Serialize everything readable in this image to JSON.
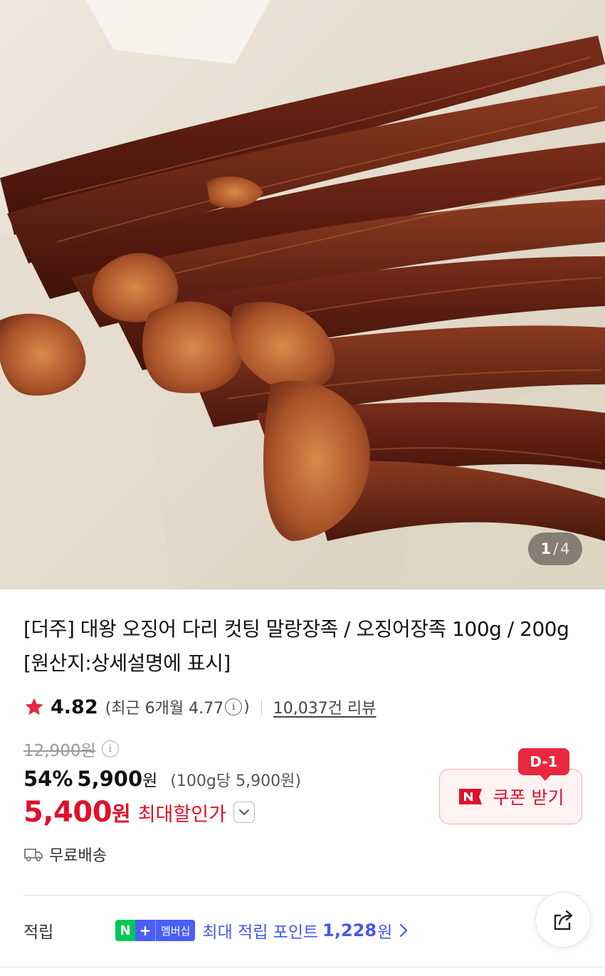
{
  "gallery": {
    "current": "1",
    "separator": "/",
    "total": "4"
  },
  "product": {
    "title": "[더주] 대왕 오징어 다리 컷팅 말랑장족 / 오징어장족 100g / 200g [원산지:상세설명에 표시]"
  },
  "rating": {
    "score": "4.82",
    "recent_prefix": "(최근 6개월 4.77",
    "recent_suffix": ")",
    "reviews": "10,037건 리뷰",
    "info_glyph": "i"
  },
  "price": {
    "original": "12,900원",
    "discount": "54%",
    "sale": "5,900",
    "sale_won": "원",
    "unit": "(100g당 5,900원)",
    "max_price": "5,400",
    "max_won": "원",
    "max_label": "최대할인가"
  },
  "coupon": {
    "badge": "D-1",
    "label": "쿠폰 받기"
  },
  "shipping": {
    "label": "무료배송"
  },
  "points": {
    "label": "적립",
    "badge_n": "N",
    "badge_plus": "+",
    "badge_text": "멤버십",
    "text": "최대 적립 포인트",
    "value": "1,228",
    "won": "원"
  },
  "colors": {
    "accent_red": "#e0102a",
    "points_blue": "#4457f0",
    "naver_green": "#03c75a",
    "star": "#e8283f"
  },
  "icons": [
    "star-icon",
    "info-icon",
    "chevron-down-icon",
    "npay-icon",
    "truck-icon",
    "chevron-right-icon",
    "share-icon"
  ]
}
